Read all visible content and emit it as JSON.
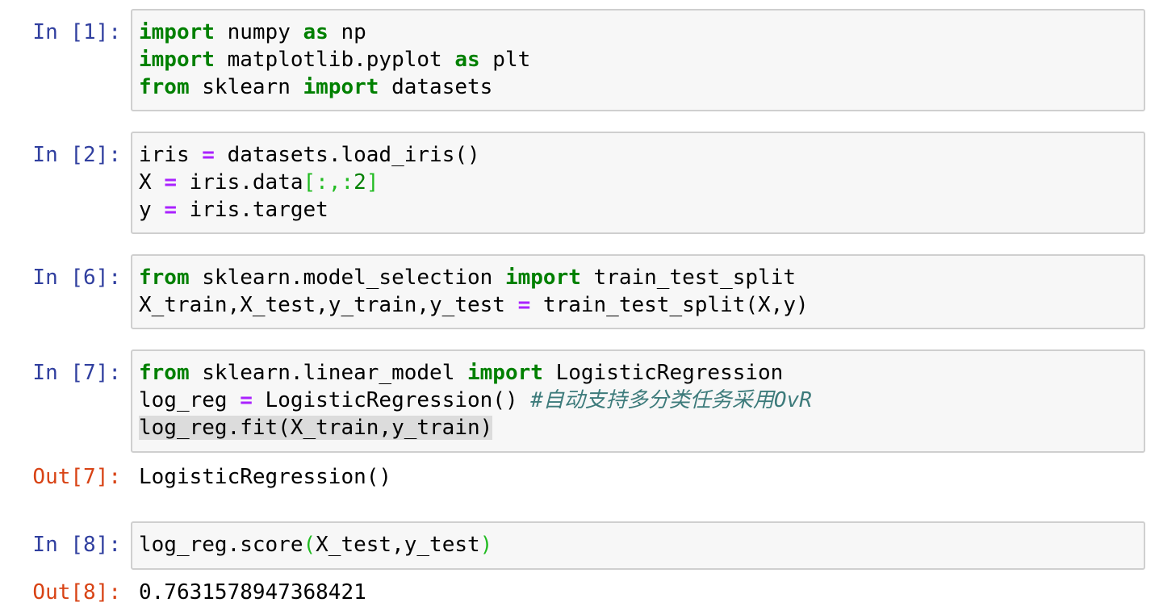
{
  "cells": [
    {
      "prompt": "In [1]:",
      "lines": [
        {
          "t1": "import",
          "t2": " numpy ",
          "t3": "as",
          "t4": " np"
        },
        {
          "t1": "import",
          "t2": " matplotlib.pyplot ",
          "t3": "as",
          "t4": " plt"
        },
        {
          "t1": "from",
          "t2": " sklearn ",
          "t3": "import",
          "t4": " datasets"
        }
      ]
    },
    {
      "prompt": "In [2]:",
      "lines": [
        {
          "t1": "iris ",
          "t2": "=",
          "t3": " datasets.load_iris()"
        },
        {
          "t1": "X ",
          "t2": "=",
          "t3": " iris.data",
          "t4": "[:,:",
          "t5": "2",
          "t6": "]"
        },
        {
          "t1": "y ",
          "t2": "=",
          "t3": " iris.target"
        }
      ]
    },
    {
      "prompt": "In [6]:",
      "lines": [
        {
          "t1": "from",
          "t2": " sklearn.model_selection ",
          "t3": "import",
          "t4": " train_test_split"
        },
        {
          "t1": "X_train,X_test,y_train,y_test ",
          "t2": "=",
          "t3": " train_test_split(X,y)"
        }
      ]
    },
    {
      "prompt": "In [7]:",
      "out_prompt": "Out[7]:",
      "output": "LogisticRegression()",
      "lines": [
        {
          "t1": "from",
          "t2": " sklearn.linear_model ",
          "t3": "import",
          "t4": " LogisticRegression"
        },
        {
          "t1": "log_reg ",
          "t2": "=",
          "t3": " LogisticRegression() ",
          "t4": "#自动支持多分类任务采用OvR"
        },
        {
          "t1": "log_reg.fit(X_train,y_train)"
        }
      ]
    },
    {
      "prompt": "In [8]:",
      "out_prompt": "Out[8]:",
      "output": "0.7631578947368421",
      "lines": [
        {
          "t1": "log_reg.score",
          "t2": "(",
          "t3": "X_test,y_test",
          "t4": ")"
        }
      ]
    }
  ],
  "colors": {
    "in_prompt": "#303f9f",
    "out_prompt": "#d84315",
    "keyword": "#008000",
    "operator": "#aa22ff",
    "comment": "#3d7b7b",
    "cell_background": "#f7f7f7",
    "cell_border": "#cfcfcf"
  }
}
